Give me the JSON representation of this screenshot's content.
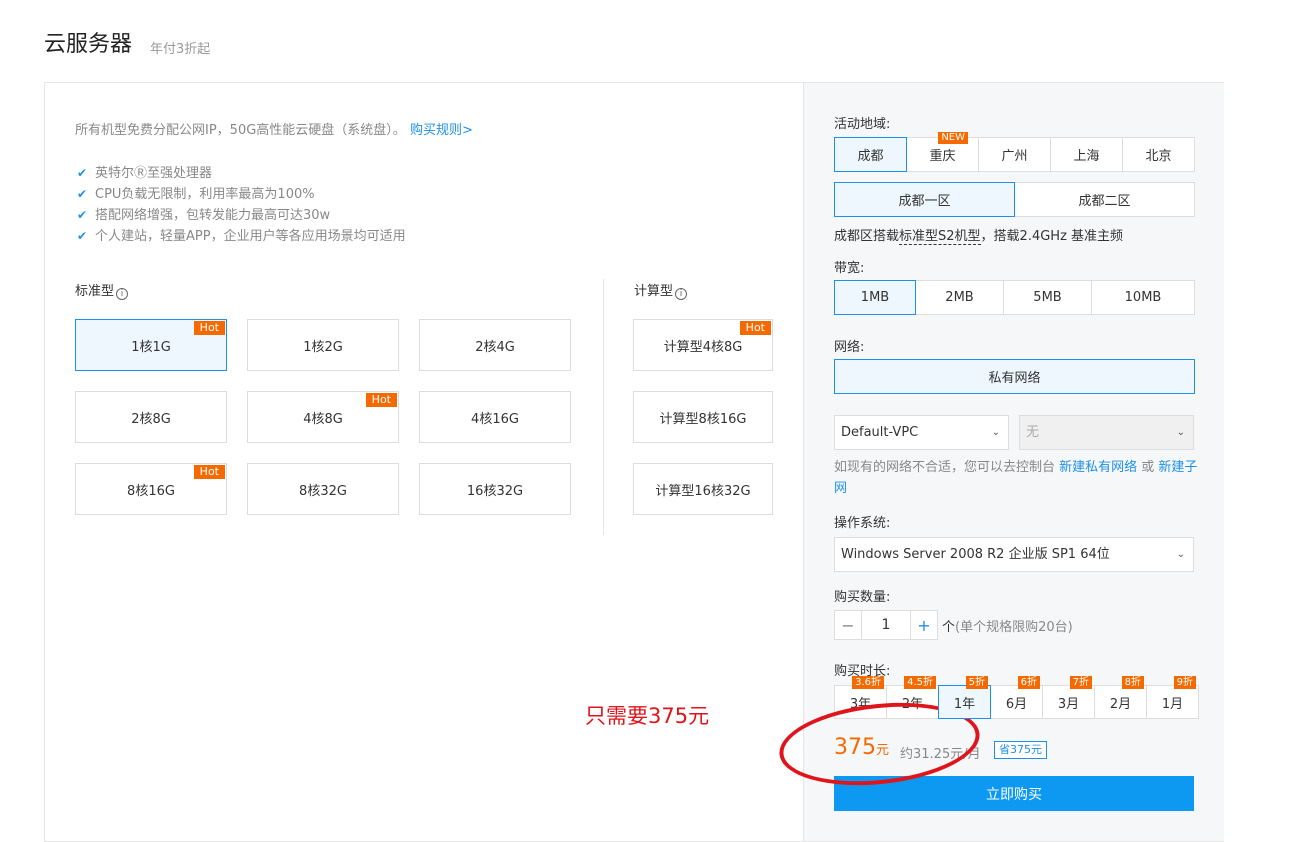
{
  "header": {
    "title": "云服务器",
    "subtitle": "年付3折起"
  },
  "left": {
    "intro_text": "所有机型免费分配公网IP，50G高性能云硬盘（系统盘）。",
    "intro_link": "购买规则>",
    "features": [
      "英特尔Ⓡ至强处理器",
      "CPU负载无限制，利用率最高为100%",
      "搭配网络增强，包转发能力最高可达30w",
      "个人建站，轻量APP，企业用户等各应用场景均可适用"
    ],
    "standard_label": "标准型",
    "compute_label": "计算型",
    "hot_label": "Hot",
    "standard_options": [
      "1核1G",
      "1核2G",
      "2核4G",
      "2核8G",
      "4核8G",
      "4核16G",
      "8核16G",
      "8核32G",
      "16核32G"
    ],
    "compute_options": [
      "计算型4核8G",
      "计算型8核16G",
      "计算型16核32G"
    ],
    "selected": "1核1G"
  },
  "right": {
    "region_label": "活动地域:",
    "regions": [
      "成都",
      "重庆",
      "广州",
      "上海",
      "北京"
    ],
    "new_badge": "NEW",
    "zones": [
      "成都一区",
      "成都二区"
    ],
    "zone_note_pre": "成都区搭载",
    "zone_note_link": "标准型S2机型",
    "zone_note_post": "，搭载2.4GHz 基准主频",
    "bandwidth_label": "带宽:",
    "bandwidths": [
      "1MB",
      "2MB",
      "5MB",
      "10MB"
    ],
    "network_label": "网络:",
    "network_option": "私有网络",
    "vpc_select": "Default-VPC",
    "subnet_select": "无",
    "hint_pre": "如现有的网络不合适，您可以去控制台 ",
    "hint_link1": "新建私有网络",
    "hint_mid": " 或 ",
    "hint_link2": "新建子网",
    "os_label": "操作系统:",
    "os_select": "Windows Server 2008 R2 企业版 SP1 64位",
    "qty_label": "购买数量:",
    "qty_minus": "−",
    "qty_value": "1",
    "qty_plus": "+",
    "qty_unit": "个",
    "qty_note": "(单个规格限购20台)",
    "duration_label": "购买时长:",
    "durations": [
      {
        "label": "3年",
        "discount": "3.6折"
      },
      {
        "label": "2年",
        "discount": "4.5折"
      },
      {
        "label": "1年",
        "discount": "5折"
      },
      {
        "label": "6月",
        "discount": "6折"
      },
      {
        "label": "3月",
        "discount": "7折"
      },
      {
        "label": "2月",
        "discount": "8折"
      },
      {
        "label": "1月",
        "discount": "9折"
      }
    ],
    "price": "375",
    "price_unit": "元",
    "monthly": "约31.25元/月",
    "save": "省375元",
    "buy_button": "立即购买"
  },
  "annotation": {
    "text": "只需要375元"
  },
  "colors": {
    "accent": "#1e90e6",
    "hot": "#f56a00",
    "annotation": "#e0141b"
  }
}
